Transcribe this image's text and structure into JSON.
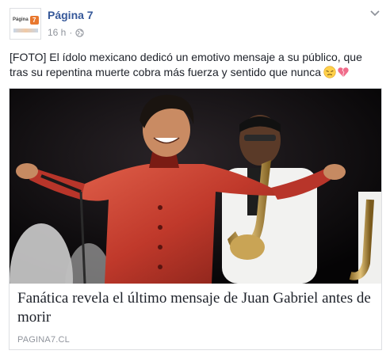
{
  "post": {
    "page_name": "Página 7",
    "timestamp": "16 h",
    "separator": "·",
    "privacy_icon": "globe-icon",
    "menu_icon": "chevron-down-icon",
    "avatar_text": "Página",
    "avatar_number": "7",
    "text": "[FOTO] El ídolo mexicano dedicó un emotivo mensaje a su público, que tras su repentina muerte cobra más fuerza y sentido que nunca",
    "emojis": [
      "pensive-face-icon",
      "broken-heart-icon"
    ],
    "colors": {
      "link": "#365899",
      "meta": "#90949c",
      "text": "#1d2129",
      "border": "#dddfe2",
      "suit": "#c0392b"
    }
  },
  "link": {
    "title": "Fanática revela el último mensaje de Juan Gabriel antes de morir",
    "domain": "PAGINA7.CL"
  }
}
